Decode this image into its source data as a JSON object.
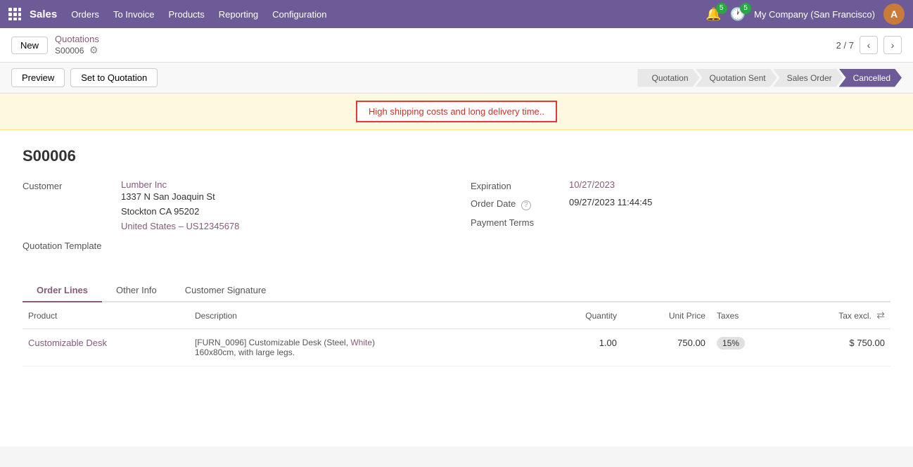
{
  "topnav": {
    "app_name": "Sales",
    "nav_items": [
      "Orders",
      "To Invoice",
      "Products",
      "Reporting",
      "Configuration"
    ],
    "notifications_count": "5",
    "activity_count": "5",
    "company": "My Company (San Francisco)",
    "avatar_initials": "A"
  },
  "breadcrumb": {
    "parent": "Quotations",
    "current": "S00006",
    "page_current": "2",
    "page_total": "7"
  },
  "toolbar": {
    "preview_label": "Preview",
    "set_quotation_label": "Set to Quotation",
    "status_steps": [
      "Quotation",
      "Quotation Sent",
      "Sales Order",
      "Cancelled"
    ]
  },
  "warning": {
    "message": "High shipping costs and long delivery time.."
  },
  "order": {
    "number": "S00006",
    "customer_label": "Customer",
    "customer_name": "Lumber Inc",
    "address_line1": "1337 N San Joaquin St",
    "address_line2": "Stockton CA 95202",
    "address_line3": "United States – US12345678",
    "quotation_template_label": "Quotation Template",
    "expiration_label": "Expiration",
    "expiration_value": "10/27/2023",
    "order_date_label": "Order Date",
    "order_date_value": "09/27/2023 11:44:45",
    "payment_terms_label": "Payment Terms",
    "payment_terms_value": ""
  },
  "tabs": {
    "items": [
      "Order Lines",
      "Other Info",
      "Customer Signature"
    ],
    "active_index": 0
  },
  "table": {
    "headers": [
      "Product",
      "Description",
      "Quantity",
      "Unit Price",
      "Taxes",
      "Tax excl."
    ],
    "rows": [
      {
        "product": "Customizable Desk",
        "description_main": "[FURN_0096] Customizable Desk (Steel, White)",
        "description_detail": "160x80cm, with large legs.",
        "description_link_text": "White",
        "quantity": "1.00",
        "unit_price": "750.00",
        "taxes": "15%",
        "tax_excl": "$ 750.00"
      }
    ]
  },
  "new_button_label": "New"
}
